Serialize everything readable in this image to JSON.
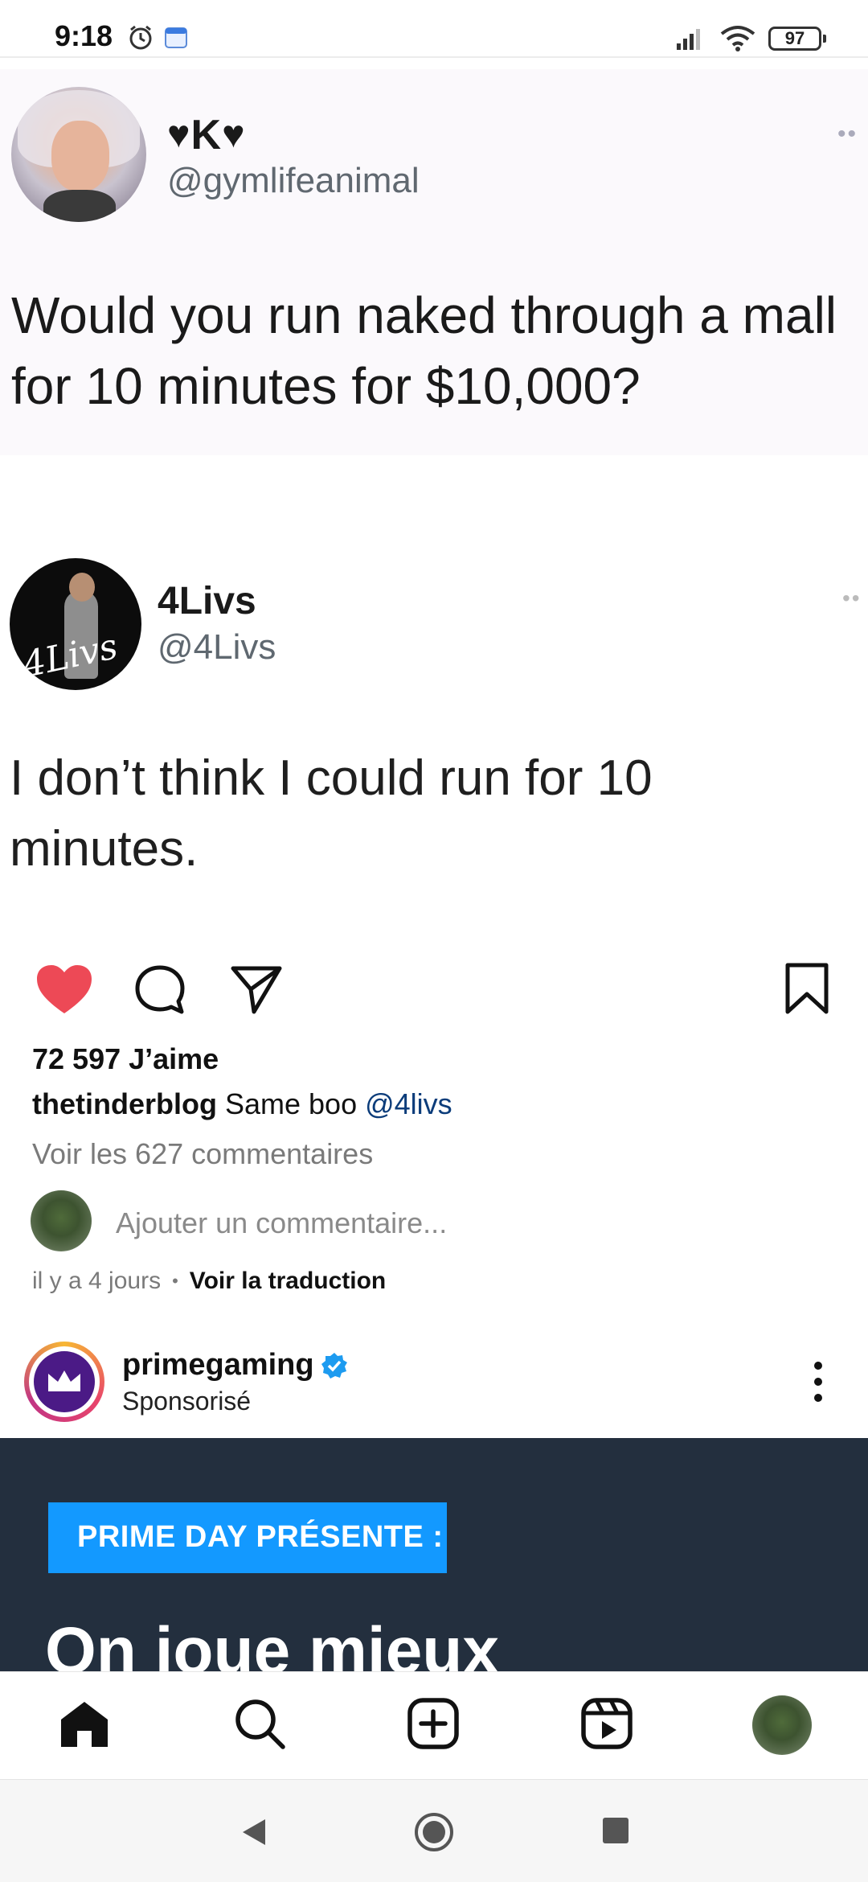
{
  "status_bar": {
    "time": "9:18",
    "battery": "97"
  },
  "tweet1": {
    "display_name_letter": "K",
    "handle": "@gymlifeanimal",
    "more": "••",
    "text": "Would you run naked through a mall for 10 minutes for $10,000?"
  },
  "tweet2": {
    "display_name": "4Livs",
    "handle": "@4Livs",
    "avatar_signature": "4Livs",
    "more": "••",
    "text": "I don’t think I could run for 10 minutes."
  },
  "post": {
    "likes": "72 597 J’aime",
    "caption_user": "thetinderblog",
    "caption_text": " Same boo ",
    "caption_mention": "@4livs",
    "view_comments": "Voir les 627 commentaires",
    "comment_placeholder": "Ajouter un commentaire...",
    "time_ago": "il y a 4 jours",
    "separator": "•",
    "translate": "Voir la traduction",
    "like_color": "#ed4956"
  },
  "sponsored": {
    "account": "primegaming",
    "label": "Sponsorisé",
    "badge": "PRIME DAY PRÉSENTE :",
    "headline": "On joue mieux",
    "ad_bg_color": "#232f3e",
    "badge_color": "#1399ff"
  },
  "icons": {
    "like": "heart-icon",
    "comment": "comment-icon",
    "share": "send-icon",
    "save": "bookmark-icon",
    "home": "home-icon",
    "search": "search-icon",
    "create": "plus-square-icon",
    "reels": "reels-icon"
  }
}
